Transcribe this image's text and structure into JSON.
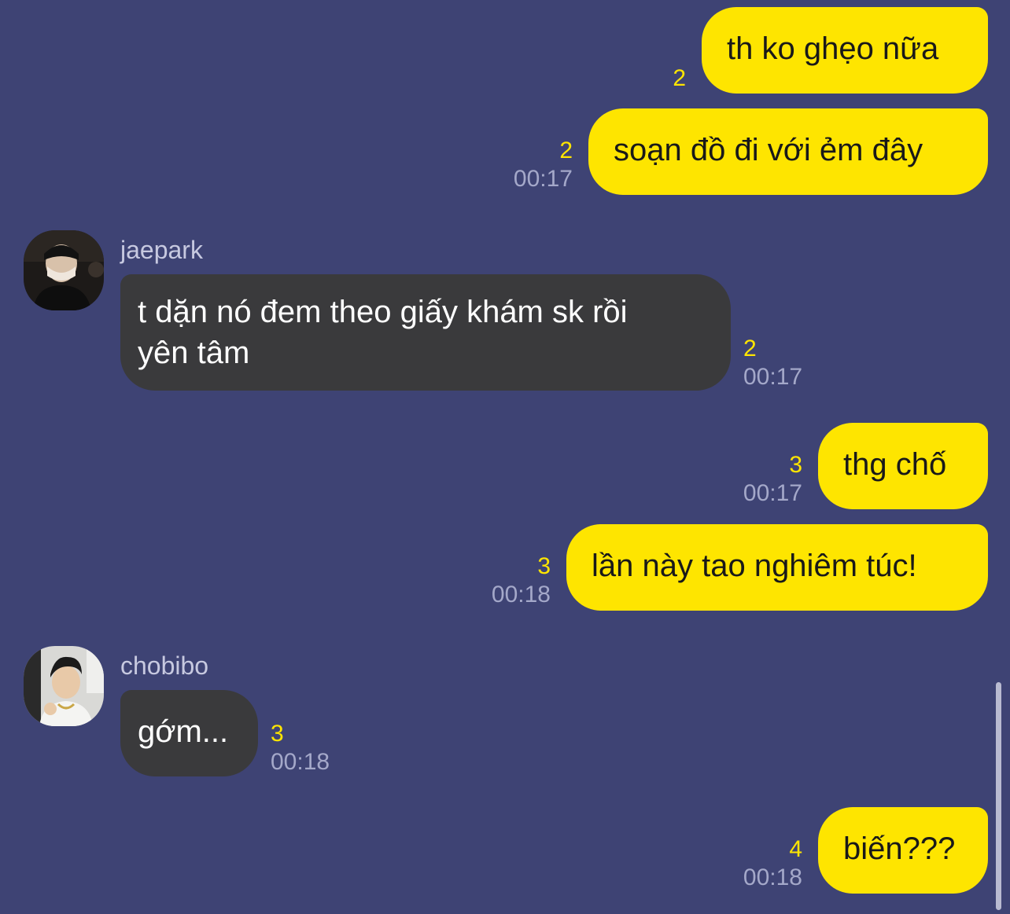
{
  "colors": {
    "background": "#3e4374",
    "my_bubble": "#fee500",
    "their_bubble": "#3a3a3c",
    "unread_count": "#fee500",
    "timestamp": "#a4a8c9"
  },
  "messages": {
    "m1": {
      "text": "th ko ghẹo nữa",
      "unread": "2",
      "time": ""
    },
    "m2": {
      "text": "soạn đồ đi với ẻm đây",
      "unread": "2",
      "time": "00:17"
    },
    "m3": {
      "sender": "jaepark",
      "avatar_icon": "user-photo-icon",
      "line1": "t dặn nó đem theo giấy khám sk rồi",
      "line2": "yên tâm",
      "unread": "2",
      "time": "00:17"
    },
    "m4": {
      "text": "thg chố",
      "unread": "3",
      "time": "00:17"
    },
    "m5": {
      "text": "lần này tao nghiêm túc!",
      "unread": "3",
      "time": "00:18"
    },
    "m6": {
      "sender": "chobibo",
      "avatar_icon": "user-photo-icon",
      "text": "gớm...",
      "unread": "3",
      "time": "00:18"
    },
    "m7": {
      "text": "biến???",
      "unread": "4",
      "time": "00:18"
    }
  }
}
